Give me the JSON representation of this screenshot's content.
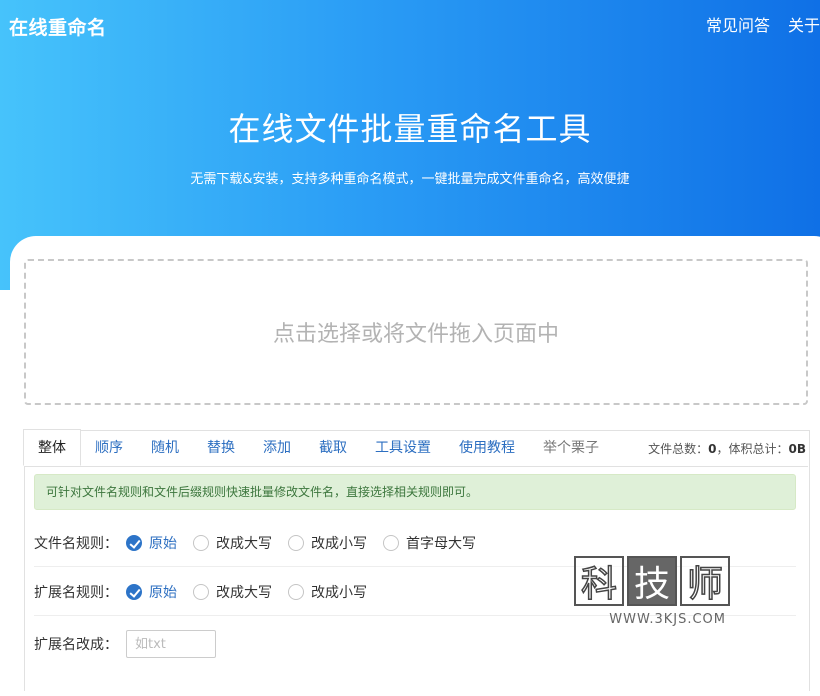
{
  "header": {
    "logo": "在线重命名",
    "nav": [
      "常见问答",
      "关于"
    ]
  },
  "hero": {
    "title": "在线文件批量重命名工具",
    "subtitle": "无需下载&安装，支持多种重命名模式，一键批量完成文件重命名，高效便捷"
  },
  "dropzone": {
    "text": "点击选择或将文件拖入页面中"
  },
  "tabs": [
    {
      "label": "整体",
      "active": true
    },
    {
      "label": "顺序"
    },
    {
      "label": "随机"
    },
    {
      "label": "替换"
    },
    {
      "label": "添加"
    },
    {
      "label": "截取"
    },
    {
      "label": "工具设置"
    },
    {
      "label": "使用教程"
    },
    {
      "label": "举个栗子"
    }
  ],
  "file_stats": {
    "total_label": "文件总数：",
    "total_value": "0",
    "size_label": "，体积总计：",
    "size_value": "0B"
  },
  "notice": "可针对文件名规则和文件后缀规则快速批量修改文件名，直接选择相关规则即可。",
  "filename_rule": {
    "label": "文件名规则：",
    "options": [
      "原始",
      "改成大写",
      "改成小写",
      "首字母大写"
    ],
    "selected": "原始"
  },
  "ext_rule": {
    "label": "扩展名规则：",
    "options": [
      "原始",
      "改成大写",
      "改成小写"
    ],
    "selected": "原始"
  },
  "ext_change": {
    "label": "扩展名改成：",
    "placeholder": "如txt",
    "value": ""
  },
  "watermark": {
    "chars": [
      "科",
      "技",
      "师"
    ],
    "url": "WWW.3KJS.COM"
  },
  "colors": {
    "hero_start": "#46c3fb",
    "hero_end": "#0f70e6",
    "link": "#2d6fc1",
    "radio_checked": "#2d74c8",
    "notice_bg": "#dff0d8",
    "notice_text": "#3c763d"
  }
}
